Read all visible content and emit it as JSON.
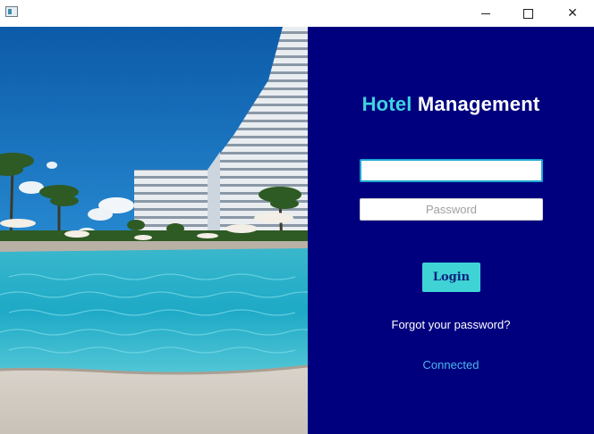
{
  "window": {
    "controls": {
      "minimize": "minimize",
      "maximize": "maximize",
      "close": "close"
    }
  },
  "image": {
    "description_icon": "hotel-pool-photo"
  },
  "login": {
    "brand_part1": "Hotel",
    "brand_part2": "Management",
    "username_value": "",
    "password_placeholder": "Password",
    "login_label": "Login",
    "forgot_label": "Forgot your password?",
    "status": "Connected"
  },
  "colors": {
    "panel_bg": "#00007f",
    "accent": "#3fd3df",
    "status": "#4ab8ea"
  }
}
